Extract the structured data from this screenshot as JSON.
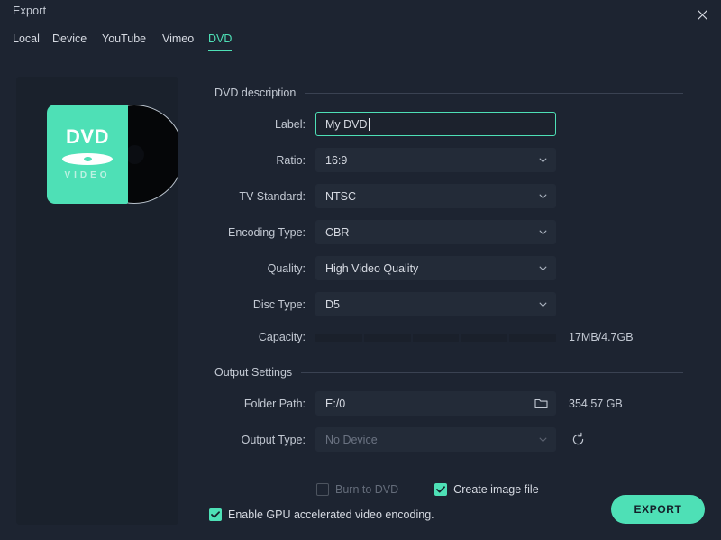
{
  "window": {
    "title": "Export",
    "close_icon": "close-icon"
  },
  "tabs": [
    {
      "label": "Local",
      "active": false
    },
    {
      "label": "Device",
      "active": false
    },
    {
      "label": "YouTube",
      "active": false
    },
    {
      "label": "Vimeo",
      "active": false
    },
    {
      "label": "DVD",
      "active": true
    }
  ],
  "preview": {
    "dvd_title": "DVD",
    "dvd_subtitle": "VIDEO"
  },
  "dvd_description": {
    "section_label": "DVD description",
    "label": {
      "label": "Label:",
      "value": "My DVD",
      "placeholder": ""
    },
    "ratio": {
      "label": "Ratio:",
      "value": "16:9"
    },
    "tv_standard": {
      "label": "TV Standard:",
      "value": "NTSC"
    },
    "encoding_type": {
      "label": "Encoding Type:",
      "value": "CBR"
    },
    "quality": {
      "label": "Quality:",
      "value": "High Video Quality"
    },
    "disc_type": {
      "label": "Disc Type:",
      "value": "D5"
    },
    "capacity": {
      "label": "Capacity:",
      "value": "17MB/4.7GB",
      "segments": 5
    }
  },
  "output_settings": {
    "section_label": "Output Settings",
    "folder_path": {
      "label": "Folder Path:",
      "value": "E:/0",
      "free_space": "354.57 GB",
      "icon": "folder-icon"
    },
    "output_type": {
      "label": "Output Type:",
      "value": "No Device",
      "reset_icon": "refresh-icon"
    }
  },
  "checkboxes": {
    "burn_to_dvd": {
      "label": "Burn to DVD",
      "checked": false,
      "disabled": true
    },
    "create_image_file": {
      "label": "Create image file",
      "checked": true,
      "disabled": false
    },
    "enable_gpu": {
      "label": "Enable GPU accelerated video encoding.",
      "checked": true,
      "disabled": false
    }
  },
  "actions": {
    "export_label": "EXPORT"
  },
  "colors": {
    "accent": "#4ee0b6",
    "background": "#1d2431",
    "panel": "#1a212c",
    "field": "#232b38",
    "text": "#d6dae2",
    "text_dim": "#8e96a4"
  }
}
